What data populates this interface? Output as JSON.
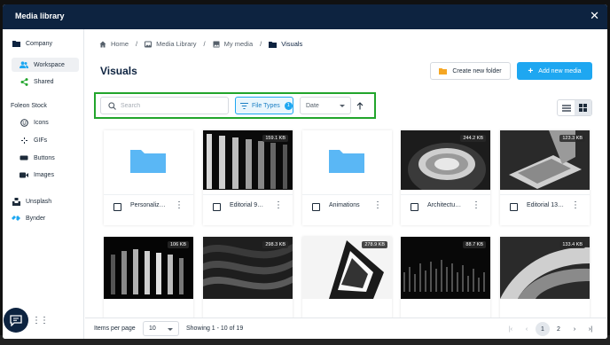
{
  "window": {
    "title": "Media library",
    "close_icon": "close-icon"
  },
  "sidebar": {
    "company_label": "Company",
    "workspace_label": "Workspace",
    "shared_label": "Shared",
    "stock_heading": "Foleon Stock",
    "icons_label": "Icons",
    "gifs_label": "GIFs",
    "buttons_label": "Buttons",
    "images_label": "Images",
    "unsplash_label": "Unsplash",
    "bynder_label": "Bynder"
  },
  "breadcrumb": [
    "Home",
    "Media Library",
    "My media",
    "Visuals"
  ],
  "page": {
    "title": "Visuals",
    "create_folder_label": "Create new folder",
    "add_media_label": "Add new media"
  },
  "toolbar": {
    "search_placeholder": "Search",
    "file_types_label": "File Types",
    "file_types_count": "1",
    "sort_value": "Date"
  },
  "grid": [
    {
      "type": "folder",
      "name": "Personaliz…",
      "size": ""
    },
    {
      "type": "image",
      "name": "Editorial 9…",
      "size": "159.1 KB"
    },
    {
      "type": "folder",
      "name": "Animations",
      "size": ""
    },
    {
      "type": "image",
      "name": "Architectu…",
      "size": "244.2 KB"
    },
    {
      "type": "image",
      "name": "Editorial 13…",
      "size": "123.3 KB"
    },
    {
      "type": "image",
      "name": "",
      "size": "106 KB"
    },
    {
      "type": "image",
      "name": "",
      "size": "298.3 KB"
    },
    {
      "type": "image",
      "name": "",
      "size": "278.9 KB"
    },
    {
      "type": "image",
      "name": "",
      "size": "88.7 KB"
    },
    {
      "type": "image",
      "name": "",
      "size": "133.4 KB"
    }
  ],
  "pagination": {
    "items_per_page_label": "Items per page",
    "items_per_page_value": "10",
    "showing": "Showing 1 - 10 of 19",
    "pages": [
      "1",
      "2"
    ],
    "current_page": "1"
  },
  "colors": {
    "header": "#0d2340",
    "accent": "#1ea7f1",
    "folder": "#5ab7f5",
    "highlight_frame": "#22a52c"
  }
}
